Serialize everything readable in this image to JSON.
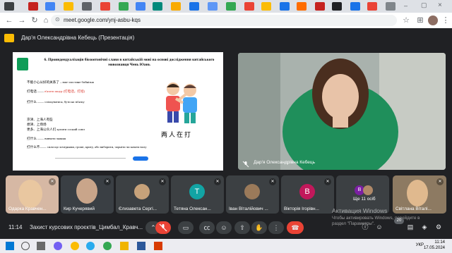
{
  "browser": {
    "url": "meet.google.com/ynj-asbu-kqs"
  },
  "meet": {
    "presenter_title": "Дар'я Олександрівна Кебець (Презентація)",
    "slide": {
      "heading": "6. Проиндендуалізація біозоотонічні слави в китайській мові на основі дослідження китайського мовознавця Чень Юань",
      "lines": [
        {
          "cn": "不能小心从好的关系了",
          "tr": "– вже злостине бойнізня"
        },
        {
          "cn": "打电话 ——",
          "tr": "в'язати шнур (打电话，打招)"
        },
        {
          "cn": "打什么 ——",
          "tr": "спілкуватися, бути на зв'язку"
        },
        {
          "cn": "京津、上海人有些",
          "tr": ""
        },
        {
          "cn": "想津、上场场",
          "tr": ""
        },
        {
          "cn": "更多、上海公众人们",
          "tr": "купити сосний союз"
        },
        {
          "cn": "打什么 ——",
          "tr": "вивчати знання"
        },
        {
          "cn": "打什么不——",
          "tr": "сили що хочеднями, гроші, криту, або виборити, чорніти чи качати волу"
        }
      ],
      "cartoon_caption": "两人在打",
      "icon_names": [
        "fighting-kids-illustration"
      ]
    },
    "camera_name": "Дар'я Олександрівна Кебець",
    "participants": [
      {
        "name": "Одарка Кравчен...",
        "type": "video",
        "color": "#6b4a3a"
      },
      {
        "name": "Кир Кучерявий",
        "type": "video",
        "color": "#4a4f55"
      },
      {
        "name": "Єлизавета Сергі...",
        "type": "avatar",
        "color": "#c7a27a",
        "initial": ""
      },
      {
        "name": "Тетяна Олексан...",
        "type": "avatar",
        "color": "#12a4a4",
        "initial": "Т"
      },
      {
        "name": "Іван Віталійович ...",
        "type": "avatar",
        "color": "#9b7a5a",
        "initial": ""
      },
      {
        "name": "Вікторія Ігорівн...",
        "type": "avatar",
        "color": "#c2185b",
        "initial": "В"
      },
      {
        "name": "Ще 11 осіб",
        "type": "more",
        "color": "#7b1fa2",
        "initial": "В"
      },
      {
        "name": "Світлана Віталі...",
        "type": "video",
        "color": "#5a4a3a"
      }
    ],
    "activation": {
      "line1": "Активация Windows",
      "line2": "Чтобы активировать Windows, перейдите в",
      "line3": "раздел \"Параметры\"."
    },
    "controls": {
      "time": "11:14",
      "meeting_name": "Захист курсових проєктів_Цимбал_Кравч...",
      "badge": "20"
    }
  },
  "taskbar": {
    "lang": "УКР",
    "time": "11:14",
    "date": "17.05.2024"
  },
  "colors": {
    "end_call": "#ea4335",
    "meet_bg": "#202124"
  }
}
